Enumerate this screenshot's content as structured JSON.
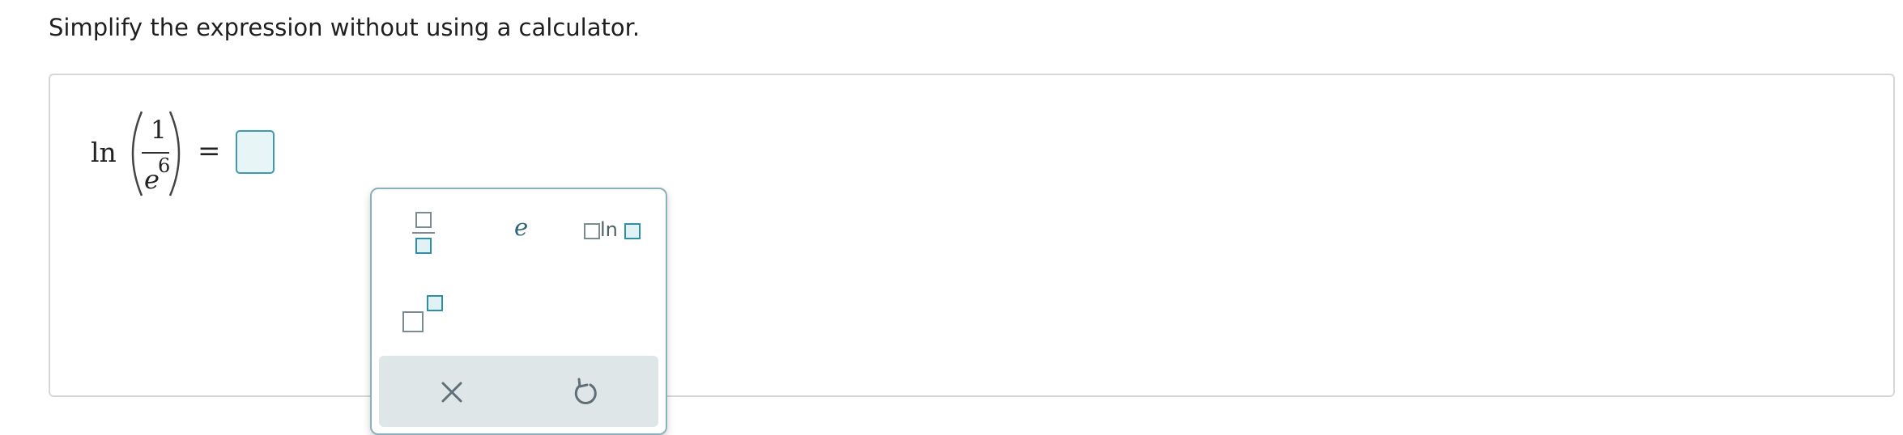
{
  "instruction": "Simplify the expression without using a calculator.",
  "expression": {
    "function": "ln",
    "numerator": "1",
    "denominator_base": "e",
    "denominator_exponent": "6",
    "equals": "="
  },
  "answer": {
    "value": ""
  },
  "palette": {
    "buttons": [
      {
        "name": "fraction",
        "icon": "fraction-template-icon"
      },
      {
        "name": "e",
        "label": "e"
      },
      {
        "name": "log-base",
        "label": "ln",
        "icon": "log-template-icon"
      },
      {
        "name": "exponent",
        "icon": "exponent-template-icon"
      }
    ],
    "actions": [
      {
        "name": "clear",
        "icon": "close-icon"
      },
      {
        "name": "undo",
        "icon": "undo-icon"
      }
    ]
  },
  "colors": {
    "accent": "#2f8fa5",
    "template_gray": "#7c8b92",
    "action_bar": "#dfe6e8",
    "panel_border": "#d4d8db"
  }
}
